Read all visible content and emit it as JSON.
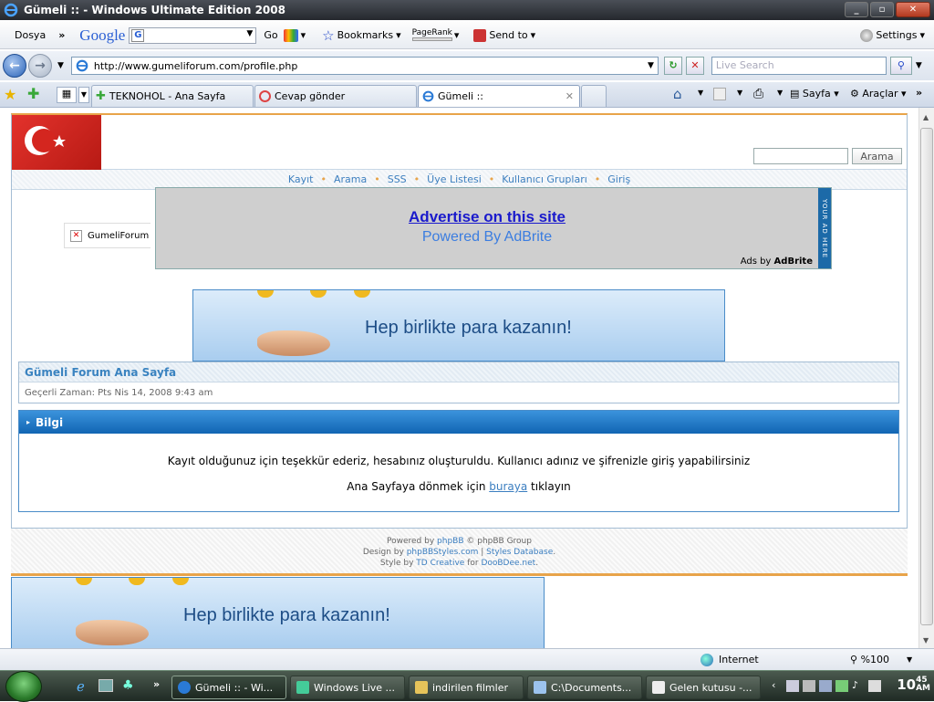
{
  "window": {
    "title": "Gümeli :: - Windows Ultimate Edition 2008"
  },
  "google_toolbar": {
    "file_menu": "Dosya",
    "google_logo": "Google",
    "go": "Go",
    "bookmarks": "Bookmarks",
    "pagerank": "PageRank",
    "send_to": "Send to",
    "settings": "Settings"
  },
  "address": {
    "url": "http://www.gumeliforum.com/profile.php",
    "live_search_placeholder": "Live Search"
  },
  "tabs": [
    {
      "label": "TEKNOHOL - Ana Sayfa"
    },
    {
      "label": "Cevap gönder"
    },
    {
      "label": "Gümeli ::"
    }
  ],
  "command_bar": {
    "page": "Sayfa",
    "tools": "Araçlar"
  },
  "page": {
    "search_button": "Arama",
    "nav": [
      "Kayıt",
      "Arama",
      "SSS",
      "Üye Listesi",
      "Kullanıcı Grupları",
      "Giriş"
    ],
    "broken_image_label": "GumeliForum",
    "ad": {
      "title": "Advertise on this site",
      "subtitle": "Powered By AdBrite",
      "ads_by": "Ads by ",
      "ads_by_brand": "AdBrite",
      "side_text": "YOUR AD HERE"
    },
    "banner_text": "Hep birlikte para kazanın!",
    "forum_title": "Gümeli Forum Ana Sayfa",
    "current_time": "Geçerli Zaman: Pts Nis 14, 2008 9:43 am",
    "info_header": "Bilgi",
    "message": "Kayıt olduğunuz için teşekkür ederiz, hesabınız oluşturuldu. Kullanıcı adınız ve şifrenizle giriş yapabilirsiniz",
    "return_prefix": "Ana Sayfaya dönmek için ",
    "return_link": "buraya",
    "return_suffix": " tıklayın",
    "footer": {
      "powered_prefix": "Powered by ",
      "phpbb": "phpBB",
      "powered_suffix": " © phpBB Group",
      "design_prefix": "Design by ",
      "design_link": "phpBBStyles.com",
      "design_sep": " | ",
      "styles_db": "Styles Database",
      "style_prefix": "Style by ",
      "td_creative": "TD Creative",
      "for_word": " for ",
      "doobdee": "DooBDee.net"
    }
  },
  "status": {
    "zone": "Internet",
    "zoom": "%100"
  },
  "taskbar": {
    "tasks": [
      {
        "label": "Gümeli :: - Wi..."
      },
      {
        "label": "Windows Live ..."
      },
      {
        "label": "indirilen filmler"
      },
      {
        "label": "C:\\Documents..."
      },
      {
        "label": "Gelen kutusu -..."
      }
    ],
    "clock_hour": "10",
    "clock_min": "45",
    "clock_ampm": "AM"
  }
}
